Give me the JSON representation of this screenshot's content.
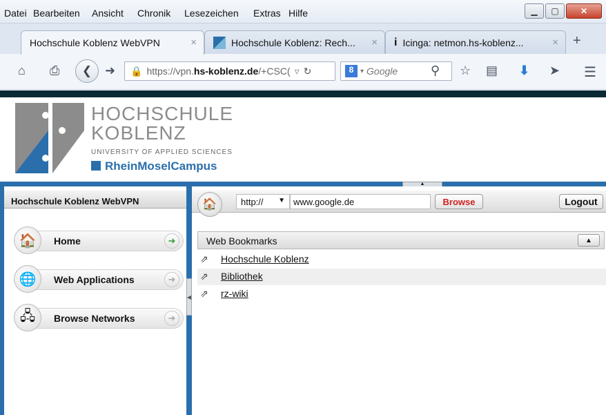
{
  "menubar": {
    "items": [
      {
        "label": "Datei"
      },
      {
        "label": "Bearbeiten"
      },
      {
        "label": "Ansicht"
      },
      {
        "label": "Chronik"
      },
      {
        "label": "Lesezeichen"
      },
      {
        "label": "Extras"
      },
      {
        "label": "Hilfe"
      }
    ],
    "window_buttons": {
      "minimize": "▁",
      "maximize": "▢",
      "close": "✕"
    }
  },
  "tabs": [
    {
      "title": "Hochschule Koblenz WebVPN",
      "active": true
    },
    {
      "title": "Hochschule Koblenz: Rech...",
      "active": false
    },
    {
      "title": "Icinga: netmon.hs-koblenz...",
      "active": false
    }
  ],
  "tab_close": "×",
  "new_tab": "+",
  "navbar": {
    "url_prefix": "https://vpn.",
    "url_domain": "hs-koblenz.de",
    "url_suffix": "/+CSC(",
    "search_placeholder": "Google"
  },
  "logo": {
    "line1": "HOCHSCHULE",
    "line2": "KOBLENZ",
    "line3": "UNIVERSITY OF APPLIED SCIENCES",
    "line4": "RheinMoselCampus"
  },
  "left_panel": {
    "title": "Hochschule Koblenz WebVPN",
    "items": [
      {
        "label": "Home"
      },
      {
        "label": "Web Applications"
      },
      {
        "label": "Browse Networks"
      }
    ]
  },
  "toolbar": {
    "protocol": "http://",
    "address_value": "www.google.de",
    "browse_label": "Browse",
    "logout_label": "Logout"
  },
  "bookmarks": {
    "header": "Web Bookmarks",
    "items": [
      {
        "label": "Hochschule Koblenz"
      },
      {
        "label": "Bibliothek"
      },
      {
        "label": "rz-wiki"
      }
    ]
  },
  "colors": {
    "accent_blue": "#2a6fab",
    "logo_blue": "#2a6fab",
    "logo_gray": "#8c8c8c",
    "browse_red": "#d02020"
  }
}
